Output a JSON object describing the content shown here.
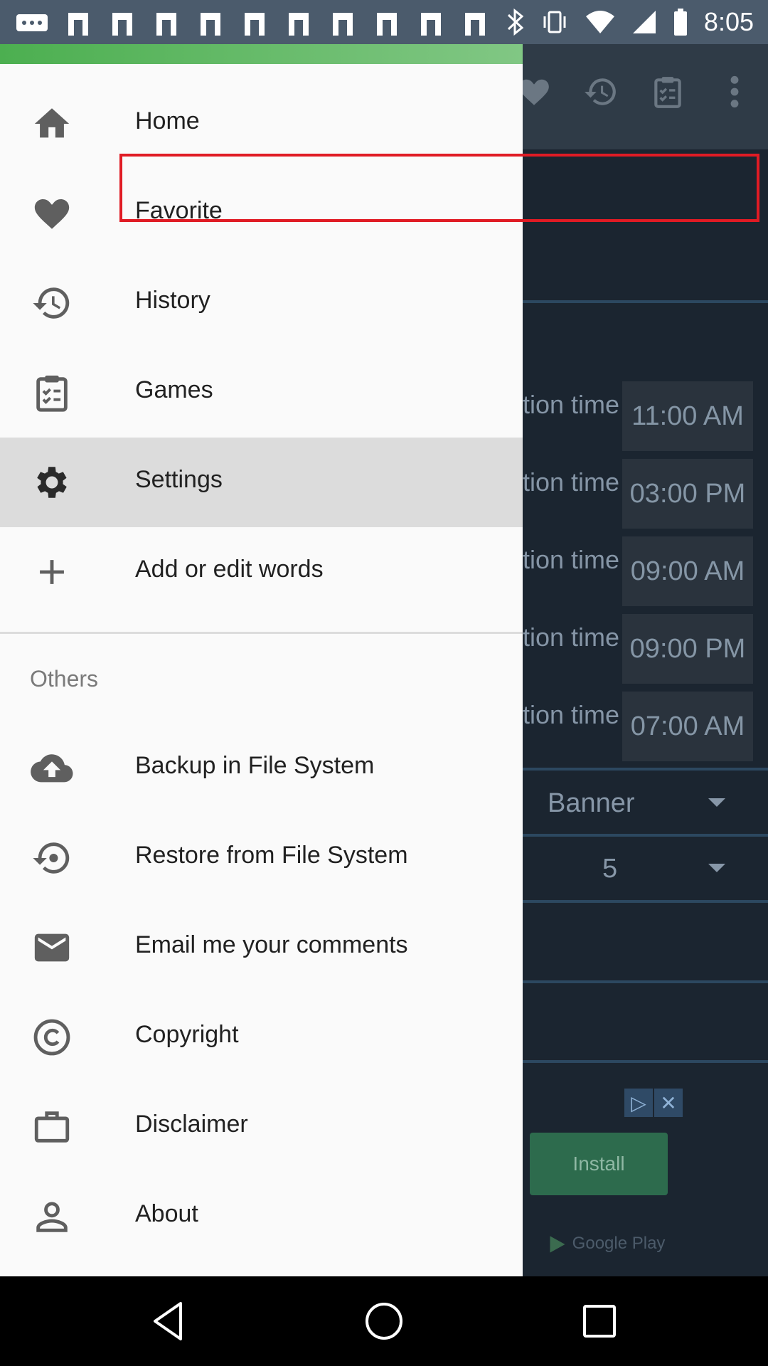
{
  "status_bar": {
    "time": "8:05",
    "notification_icons": [
      "messages-icon",
      "mail-icon"
    ],
    "status_icons": [
      "bluetooth-icon",
      "vibrate-icon",
      "wifi-icon",
      "signal-icon",
      "battery-icon"
    ]
  },
  "app_toolbar": {
    "icons": [
      "heart-icon",
      "history-icon",
      "clipboard-icon",
      "more-vert-icon"
    ]
  },
  "drawer": {
    "accent_color": "#4caf50",
    "main_items": [
      {
        "label": "Home",
        "icon": "home-icon"
      },
      {
        "label": "Favorite",
        "icon": "heart-icon"
      },
      {
        "label": "History",
        "icon": "history-icon"
      },
      {
        "label": "Games",
        "icon": "clipboard-icon"
      },
      {
        "label": "Settings",
        "icon": "gear-icon",
        "active": true
      },
      {
        "label": "Add or edit words",
        "icon": "plus-icon"
      }
    ],
    "others_heading": "Others",
    "other_items": [
      {
        "label": "Backup in File System",
        "icon": "cloud-upload-icon"
      },
      {
        "label": "Restore from File System",
        "icon": "restore-icon"
      },
      {
        "label": "Email me your comments",
        "icon": "email-icon"
      },
      {
        "label": "Copyright",
        "icon": "copyright-icon"
      },
      {
        "label": "Disclaimer",
        "icon": "briefcase-icon"
      },
      {
        "label": "About",
        "icon": "person-icon"
      }
    ]
  },
  "background": {
    "time_rows": [
      {
        "label": "tion time",
        "value": "11:00 AM"
      },
      {
        "label": "tion time",
        "value": "03:00 PM"
      },
      {
        "label": "tion time",
        "value": "09:00 AM"
      },
      {
        "label": "tion time",
        "value": "09:00 PM"
      },
      {
        "label": "tion time",
        "value": "07:00 AM"
      }
    ],
    "dropdown_1": "Banner",
    "dropdown_2": "5",
    "ad": {
      "install_label": "Install",
      "store_label": "Google Play"
    }
  },
  "highlight_color": "#e01b24"
}
